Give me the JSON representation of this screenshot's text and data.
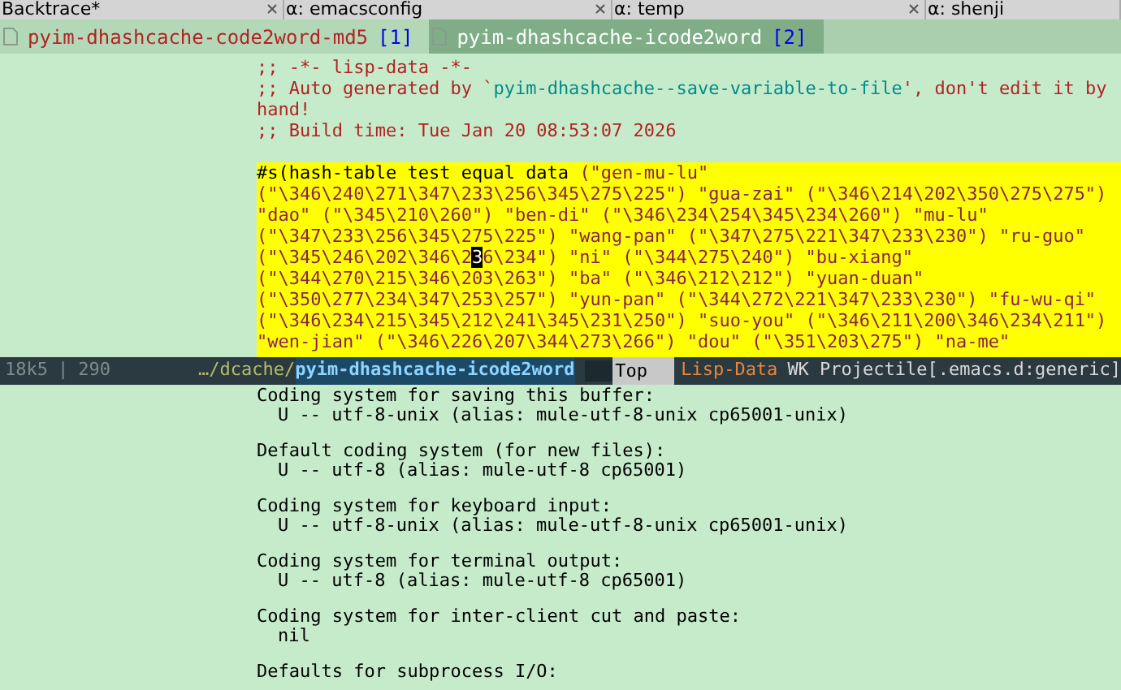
{
  "frame_tabs": [
    {
      "label": "Backtrace*",
      "closable": true,
      "selected": false
    },
    {
      "label": "α: emacsconfig",
      "closable": true,
      "selected": false
    },
    {
      "label": "α: temp",
      "closable": true,
      "selected": false
    },
    {
      "label": "α: shenji",
      "closable": false,
      "selected": false
    }
  ],
  "buffer_tabs": [
    {
      "name": "pyim-dhashcache-code2word-md5",
      "index": "[1]",
      "selected": false
    },
    {
      "name": "pyim-dhashcache-icode2word",
      "index": "[2]",
      "selected": true
    }
  ],
  "header_comments": [
    {
      "kind": "plain",
      "text": ";; -*- lisp-data -*-"
    },
    {
      "kind": "generated",
      "before": ";; Auto generated by `",
      "symbol": "pyim-dhashcache--save-variable-to-file",
      "after": "', don't edit it by hand!"
    },
    {
      "kind": "plain",
      "text": ";; Build time: Tue Jan 20 08:53:07 2026"
    }
  ],
  "hash_lines": [
    {
      "prefix": "#s(hash-table test equal data ",
      "text": "(\"gen-mu-lu\""
    },
    {
      "text": "(\"\\346\\240\\271\\347\\233\\256\\345\\275\\225\") \"gua-zai\" (\"\\346\\214\\202\\350\\275\\275\")"
    },
    {
      "text": "\"dao\" (\"\\345\\210\\260\") \"ben-di\" (\"\\346\\234\\254\\345\\234\\260\") \"mu-lu\""
    },
    {
      "text": "(\"\\347\\233\\256\\345\\275\\225\") \"wang-pan\" (\"\\347\\275\\221\\347\\233\\230\") \"ru-guo\""
    },
    {
      "text": "(\"\\345\\246\\202\\346\\2",
      "cursor": "3",
      "after": "6\\234\") \"ni\" (\"\\344\\275\\240\") \"bu-xiang\""
    },
    {
      "text": "(\"\\344\\270\\215\\346\\203\\263\") \"ba\" (\"\\346\\212\\212\") \"yuan-duan\""
    },
    {
      "text": "(\"\\350\\277\\234\\347\\253\\257\") \"yun-pan\" (\"\\344\\272\\221\\347\\233\\230\") \"fu-wu-qi\""
    },
    {
      "text": "(\"\\346\\234\\215\\345\\212\\241\\345\\231\\250\") \"suo-you\" (\"\\346\\211\\200\\346\\234\\211\")"
    },
    {
      "text": "\"wen-jian\" (\"\\346\\226\\207\\344\\273\\266\") \"dou\" (\"\\351\\203\\275\") \"na-me\""
    }
  ],
  "mode_line": {
    "size": "18k5",
    "separator": "|",
    "line": "290",
    "dir": "…/dcache/",
    "buffer": "pyim-dhashcache-icode2word",
    "position": "Top",
    "major_mode": "Lisp-Data",
    "minor_modes": "WK Projectile[.emacs.d:generic]"
  },
  "help_sections": [
    {
      "heading": "Coding system for saving this buffer:",
      "value": "U -- utf-8-unix (alias: mule-utf-8-unix cp65001-unix)"
    },
    {
      "heading": "Default coding system (for new files):",
      "value": "U -- utf-8 (alias: mule-utf-8 cp65001)"
    },
    {
      "heading": "Coding system for keyboard input:",
      "value": "U -- utf-8-unix (alias: mule-utf-8-unix cp65001-unix)"
    },
    {
      "heading": "Coding system for terminal output:",
      "value": "U -- utf-8 (alias: mule-utf-8 cp65001)"
    },
    {
      "heading": "Coding system for inter-client cut and paste:",
      "value": "nil"
    },
    {
      "heading": "Defaults for subprocess I/O:"
    }
  ]
}
